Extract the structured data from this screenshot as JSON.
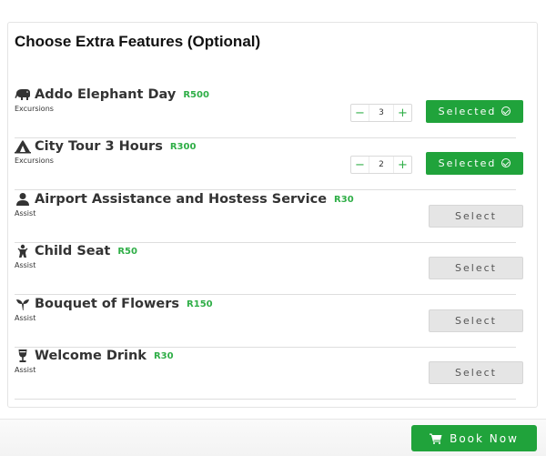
{
  "section": {
    "heading": "Choose Extra Features (Optional)"
  },
  "features": [
    {
      "icon": "elephant-icon",
      "name": "Addo Elephant Day",
      "price": "R500",
      "category": "Excursions",
      "status": "selected",
      "quantity": "3",
      "button": "Selected"
    },
    {
      "icon": "tent-icon",
      "name": "City Tour 3 Hours",
      "price": "R300",
      "category": "Excursions",
      "status": "selected",
      "quantity": "2",
      "button": "Selected"
    },
    {
      "icon": "user-icon",
      "name": "Airport Assistance and Hostess Service",
      "price": "R30",
      "category": "Assist",
      "status": "unselected",
      "button": "Select"
    },
    {
      "icon": "child-icon",
      "name": "Child Seat",
      "price": "R50",
      "category": "Assist",
      "status": "unselected",
      "button": "Select"
    },
    {
      "icon": "bouquet-icon",
      "name": "Bouquet of Flowers",
      "price": "R150",
      "category": "Assist",
      "status": "unselected",
      "button": "Select"
    },
    {
      "icon": "wine-glass-icon",
      "name": "Welcome Drink",
      "price": "R30",
      "category": "Assist",
      "status": "unselected",
      "button": "Select"
    }
  ],
  "stepper": {
    "minus": "−",
    "plus": "+"
  },
  "footer": {
    "book_label": "Book Now",
    "book_icon": "cart-icon"
  },
  "colors": {
    "accent": "#20a33b",
    "price": "#2fae47",
    "button_gray": "#e5e5e5"
  }
}
